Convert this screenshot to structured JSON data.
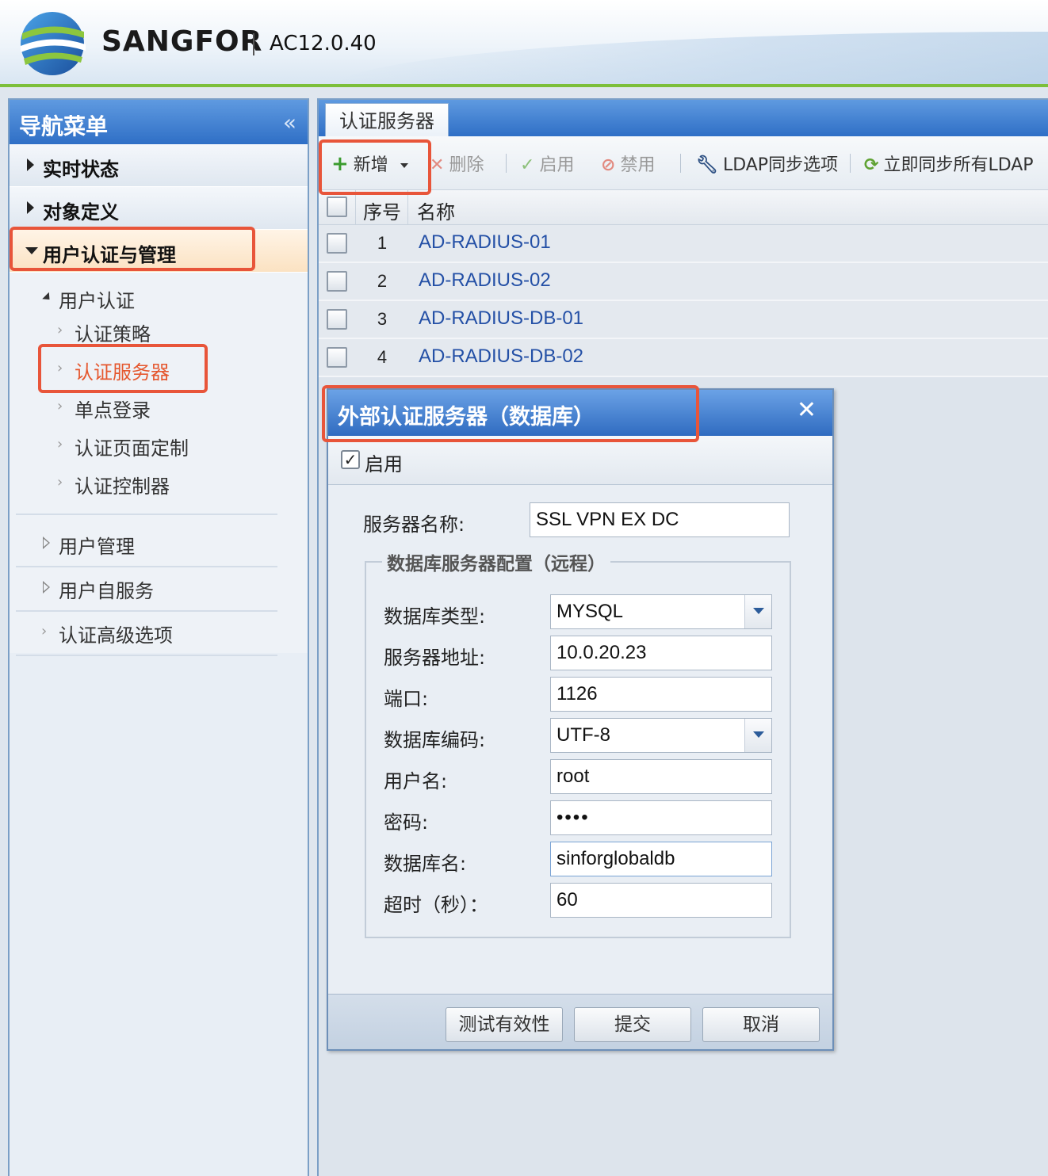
{
  "header": {
    "brand": "SANGFOR",
    "version": "AC12.0.40"
  },
  "sidebar": {
    "title": "导航菜单",
    "collapse": "«",
    "groups": [
      {
        "label": "实时状态"
      },
      {
        "label": "对象定义"
      },
      {
        "label": "用户认证与管理"
      }
    ],
    "tree": {
      "auth": "用户认证",
      "auth_children": [
        "认证策略",
        "认证服务器",
        "单点登录",
        "认证页面定制",
        "认证控制器"
      ],
      "others": [
        "用户管理",
        "用户自服务",
        "认证高级选项"
      ]
    }
  },
  "main": {
    "tab": "认证服务器",
    "toolbar": {
      "add": "新增",
      "delete": "删除",
      "enable": "启用",
      "disable": "禁用",
      "ldap_options": "LDAP同步选项",
      "sync_all": "立即同步所有LDAP"
    },
    "table": {
      "headers": [
        "序号",
        "名称"
      ],
      "rows": [
        {
          "num": "1",
          "name": "AD-RADIUS-01"
        },
        {
          "num": "2",
          "name": "AD-RADIUS-02"
        },
        {
          "num": "3",
          "name": "AD-RADIUS-DB-01"
        },
        {
          "num": "4",
          "name": "AD-RADIUS-DB-02"
        }
      ]
    }
  },
  "dialog": {
    "title": "外部认证服务器（数据库）",
    "close": "✕",
    "enable_label": "启用",
    "server_name_label": "服务器名称:",
    "server_name": "SSL VPN EX DC",
    "fieldset_legend": "数据库服务器配置（远程）",
    "fields": [
      {
        "label": "数据库类型:",
        "value": "MYSQL"
      },
      {
        "label": "服务器地址:",
        "value": "10.0.20.23"
      },
      {
        "label": "端口:",
        "value": "1126"
      },
      {
        "label": "数据库编码:",
        "value": "UTF-8"
      },
      {
        "label": "用户名:",
        "value": "root"
      },
      {
        "label": "密码:",
        "value": "••••"
      },
      {
        "label": "数据库名:",
        "value": "sinforglobaldb"
      },
      {
        "label": "超时（秒）：",
        "value": "60"
      }
    ],
    "buttons": {
      "test": "测试有效性",
      "submit": "提交",
      "cancel": "取消"
    }
  },
  "colors": {
    "accent_blue": "#2f6fc6",
    "highlight": "#e8553a",
    "link": "#2450a6"
  }
}
